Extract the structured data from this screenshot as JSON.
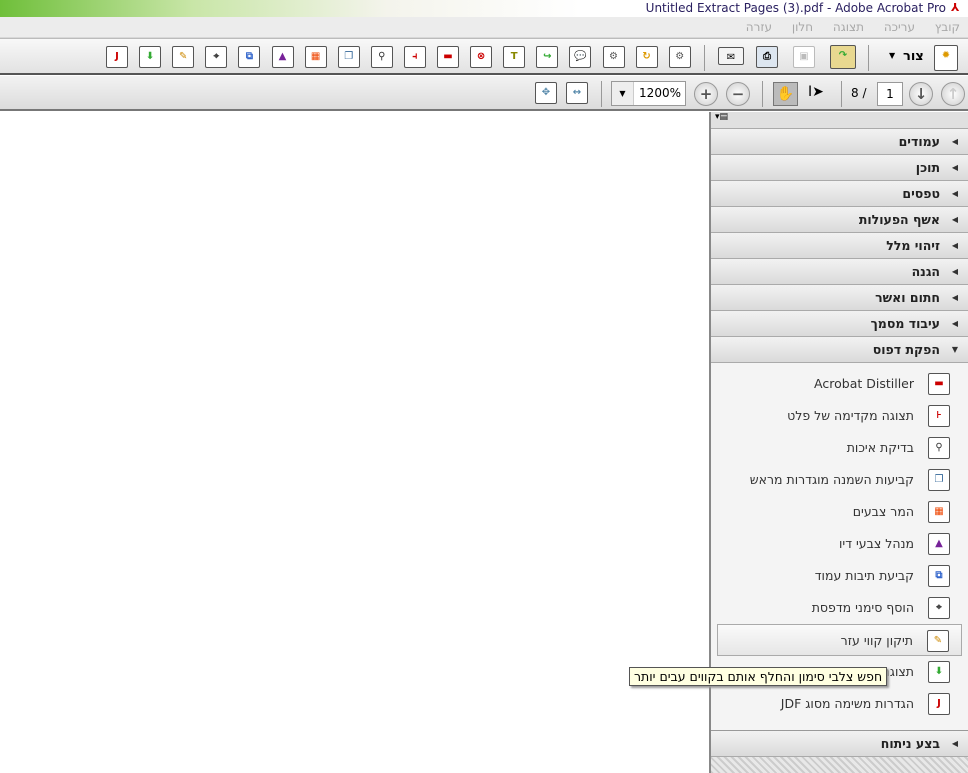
{
  "window": {
    "title": "Untitled Extract Pages (3).pdf - Adobe Acrobat Pro",
    "app_icon": "pdf-icon"
  },
  "menu": [
    "קובץ",
    "עריכה",
    "תצוגה",
    "חלון",
    "עזרה"
  ],
  "toolbar": {
    "create_label": "צור",
    "icons": [
      "jdf-info-icon",
      "output-preview-icon",
      "fix-hairlines-icon",
      "printer-marks-icon",
      "page-boxes-icon",
      "ink-manager-icon",
      "convert-colors-icon",
      "trap-presets-icon",
      "preflight-icon",
      "flattener-preview-icon",
      "acrobat-distiller-icon",
      "delete-page-icon",
      "typewriter-icon",
      "export-icon",
      "comment-icon",
      "document-settings-icon",
      "document-action-icon",
      "gear-icon"
    ]
  },
  "nav": {
    "zoom": "1200%",
    "current_page": "1",
    "total_pages": "8 /"
  },
  "panel": {
    "sections": [
      "עמודים",
      "תוכן",
      "טפסים",
      "אשף הפעולות",
      "זיהוי מלל",
      "הגנה",
      "חתום ואשר",
      "עיבוד מסמך"
    ],
    "open_section": "הפקת דפוס",
    "items": [
      {
        "label": "Acrobat Distiller",
        "icon": "acrobat-distiller-icon"
      },
      {
        "label": "תצוגה מקדימה של פלט",
        "icon": "flattener-preview-icon"
      },
      {
        "label": "בדיקת איכות",
        "icon": "preflight-icon"
      },
      {
        "label": "קביעות השמנה מוגדרות מראש",
        "icon": "trap-presets-icon"
      },
      {
        "label": "המר צבעים",
        "icon": "convert-colors-icon"
      },
      {
        "label": "מנהל צבעי דיו",
        "icon": "ink-manager-icon"
      },
      {
        "label": "קביעת תיבות עמוד",
        "icon": "page-boxes-icon"
      },
      {
        "label": "הוסף סימני מדפסת",
        "icon": "printer-marks-icon"
      },
      {
        "label": "תיקון קווי עזר",
        "icon": "fix-hairlines-icon"
      },
      {
        "label": "תצוגה",
        "icon": "output-preview-icon"
      },
      {
        "label": "הגדרות משימה מסוג JDF",
        "icon": "jdf-info-icon"
      }
    ],
    "bottom_section": "בצע ניתוח"
  },
  "tooltip": "חפש צלבי סימון והחלף אותם בקווים עבים יותר"
}
